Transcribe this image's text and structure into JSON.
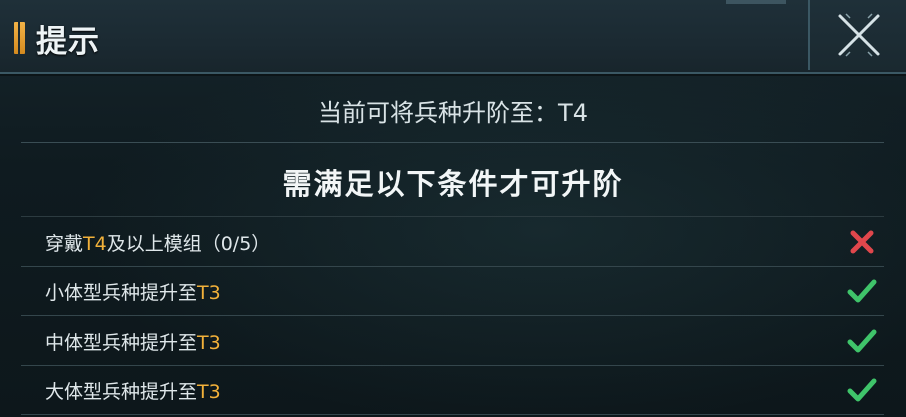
{
  "dialog": {
    "title": "提示"
  },
  "info": {
    "text": "当前可将兵种升阶至：T4"
  },
  "section": {
    "title": "需满足以下条件才可升阶"
  },
  "conditions": [
    {
      "prefix": "穿戴",
      "highlight": "T4",
      "suffix": "及以上模组（0/5）",
      "status": "unmet",
      "status_icon": "cross-icon",
      "color": "#e0474c"
    },
    {
      "prefix": "小体型兵种提升至",
      "highlight": "T3",
      "suffix": "",
      "status": "met",
      "status_icon": "check-icon",
      "color": "#3fc46a"
    },
    {
      "prefix": "中体型兵种提升至",
      "highlight": "T3",
      "suffix": "",
      "status": "met",
      "status_icon": "check-icon",
      "color": "#3fc46a"
    },
    {
      "prefix": "大体型兵种提升至",
      "highlight": "T3",
      "suffix": "",
      "status": "met",
      "status_icon": "check-icon",
      "color": "#3fc46a"
    }
  ],
  "colors": {
    "highlight": "#f2b13a",
    "accent": "#e29a2a"
  }
}
